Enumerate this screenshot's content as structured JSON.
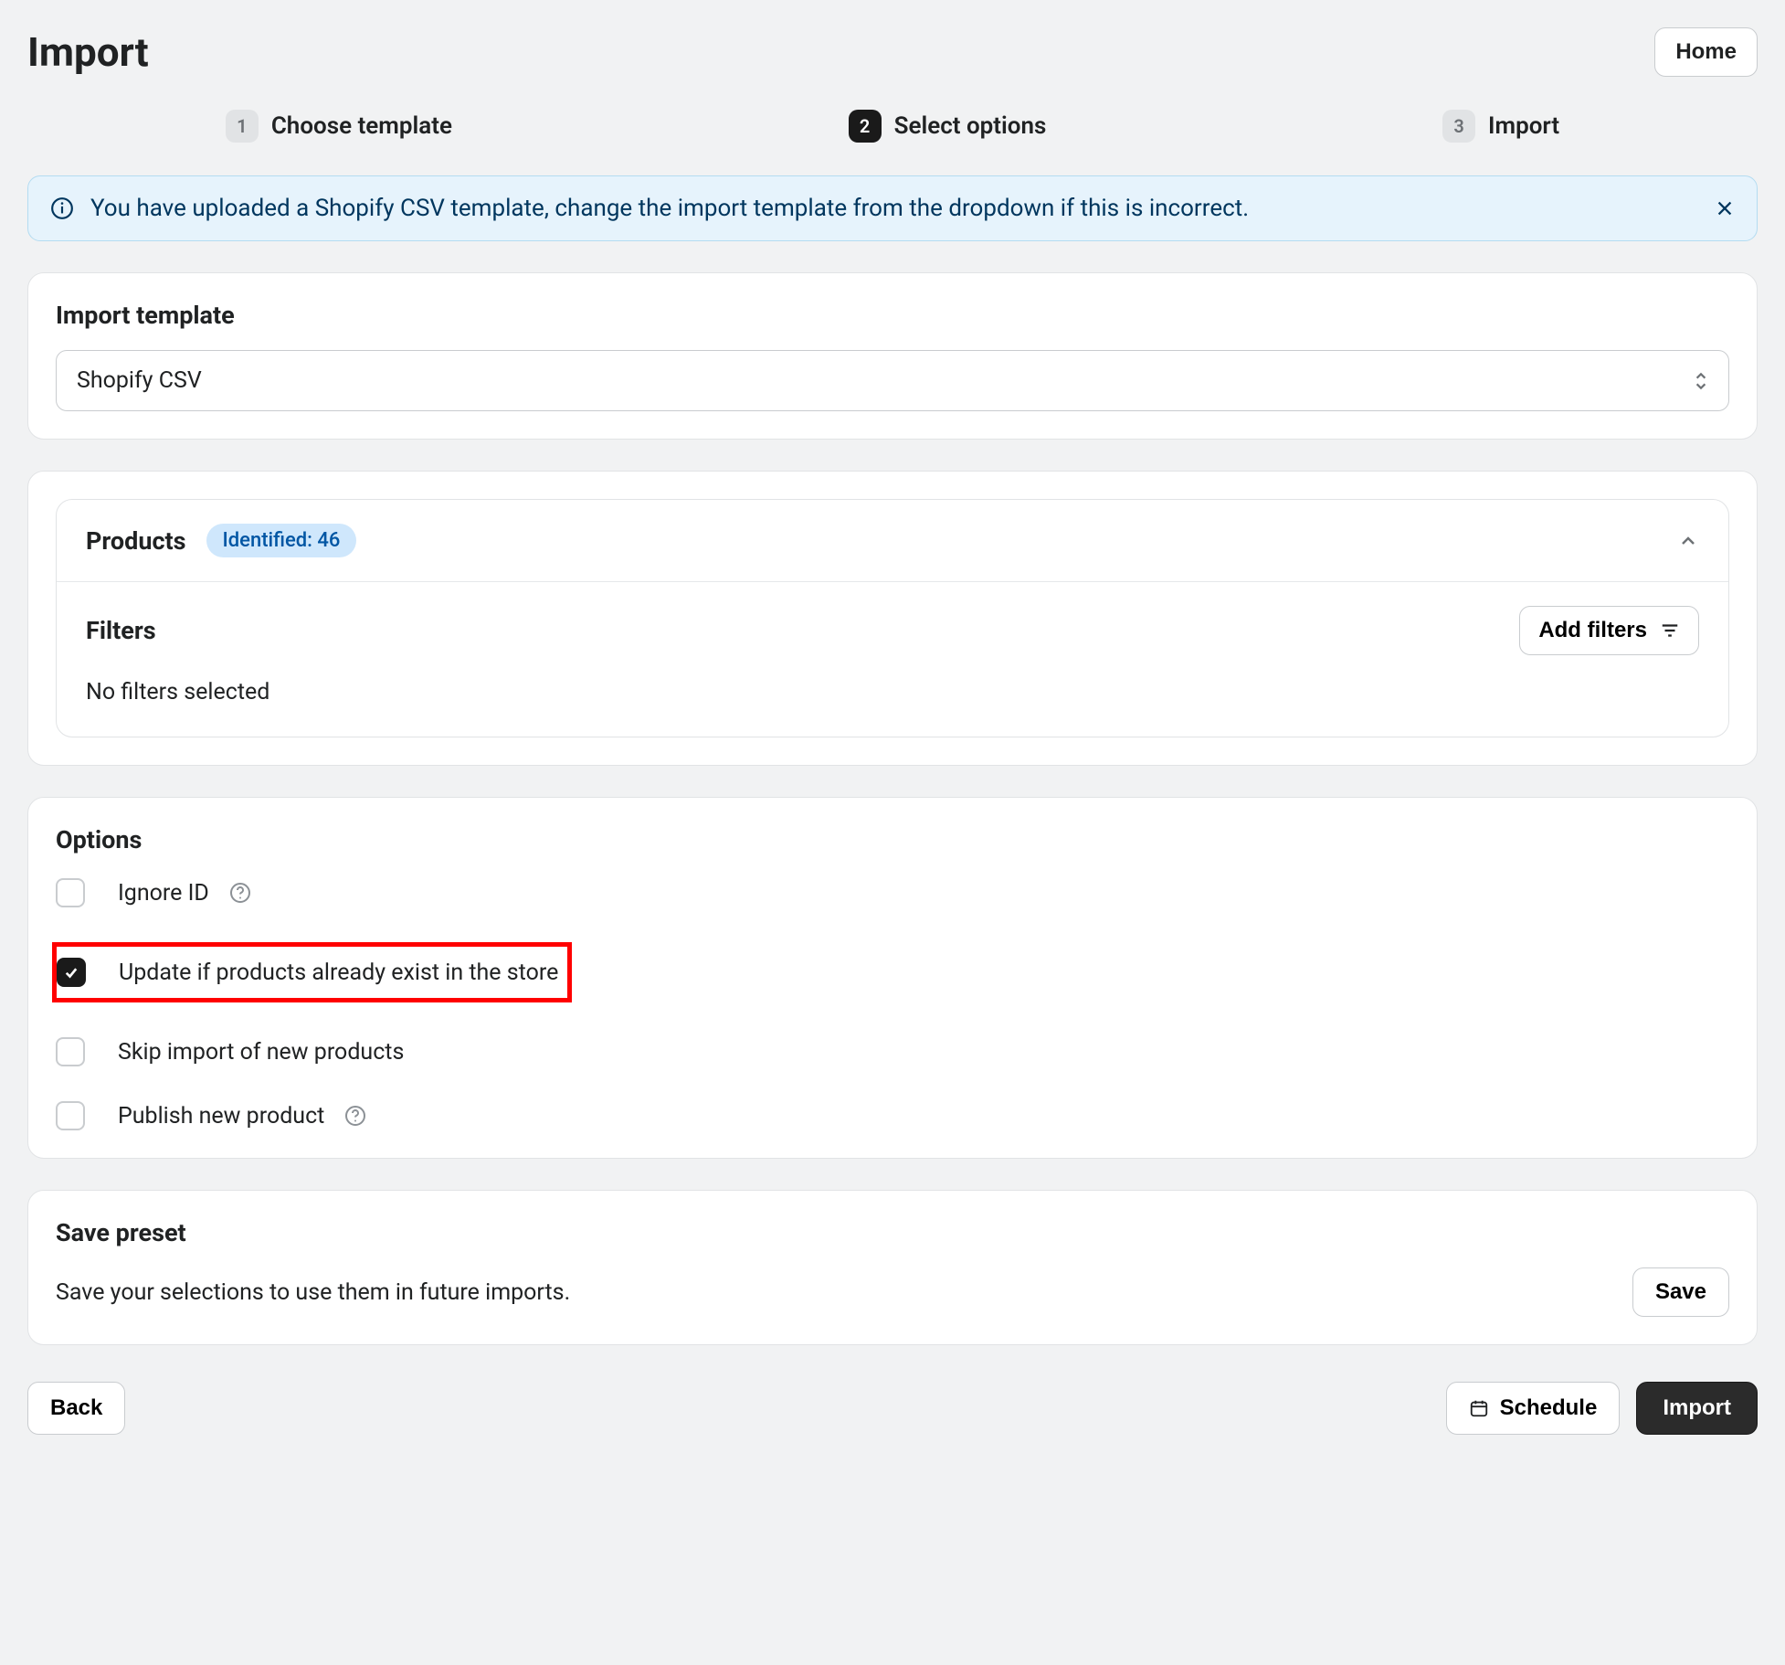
{
  "header": {
    "title": "Import",
    "home_label": "Home"
  },
  "steps": [
    {
      "num": "1",
      "label": "Choose template",
      "active": false
    },
    {
      "num": "2",
      "label": "Select options",
      "active": true
    },
    {
      "num": "3",
      "label": "Import",
      "active": false
    }
  ],
  "banner": {
    "text": "You have uploaded a Shopify CSV template, change the import template from the dropdown if this is incorrect."
  },
  "import_template": {
    "heading": "Import template",
    "selected": "Shopify CSV"
  },
  "products": {
    "heading": "Products",
    "badge": "Identified: 46",
    "filters_heading": "Filters",
    "add_filters_label": "Add filters",
    "no_filters_text": "No filters selected"
  },
  "options": {
    "heading": "Options",
    "items": [
      {
        "label": "Ignore ID",
        "checked": false,
        "has_help": true,
        "highlighted": false
      },
      {
        "label": "Update if products already exist in the store",
        "checked": true,
        "has_help": false,
        "highlighted": true
      },
      {
        "label": "Skip import of new products",
        "checked": false,
        "has_help": false,
        "highlighted": false
      },
      {
        "label": "Publish new product",
        "checked": false,
        "has_help": true,
        "highlighted": false
      }
    ]
  },
  "preset": {
    "heading": "Save preset",
    "description": "Save your selections to use them in future imports.",
    "save_label": "Save"
  },
  "footer": {
    "back_label": "Back",
    "schedule_label": "Schedule",
    "import_label": "Import"
  }
}
